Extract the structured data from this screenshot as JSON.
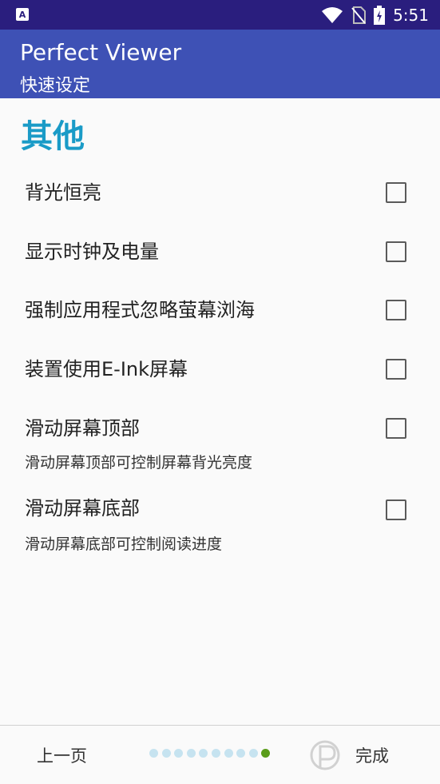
{
  "status_bar": {
    "time": "5:51",
    "left_icon": "A",
    "icons": [
      "wifi-icon",
      "no-sim-icon",
      "battery-charging-icon"
    ]
  },
  "app_bar": {
    "title": "Perfect Viewer",
    "subtitle": "快速设定"
  },
  "section": {
    "title": "其他"
  },
  "preferences": [
    {
      "title": "背光恒亮",
      "summary": "",
      "checked": false
    },
    {
      "title": "显示时钟及电量",
      "summary": "",
      "checked": false
    },
    {
      "title": "强制应用程式忽略萤幕浏海",
      "summary": "",
      "checked": false
    },
    {
      "title": "装置使用E-Ink屏幕",
      "summary": "",
      "checked": false
    },
    {
      "title": "滑动屏幕顶部",
      "summary": "滑动屏幕顶部可控制屏幕背光亮度",
      "checked": false
    },
    {
      "title": "滑动屏幕底部",
      "summary": "滑动屏幕底部可控制阅读进度",
      "checked": false
    }
  ],
  "footer": {
    "prev_label": "上一页",
    "done_label": "完成",
    "page_count": 10,
    "current_page": 10
  },
  "colors": {
    "status_bar": "#2a1e7e",
    "app_bar": "#3e51b5",
    "section_title": "#1a9bc7",
    "dot_inactive": "#c6e3f0",
    "dot_active": "#5a9c1a"
  }
}
